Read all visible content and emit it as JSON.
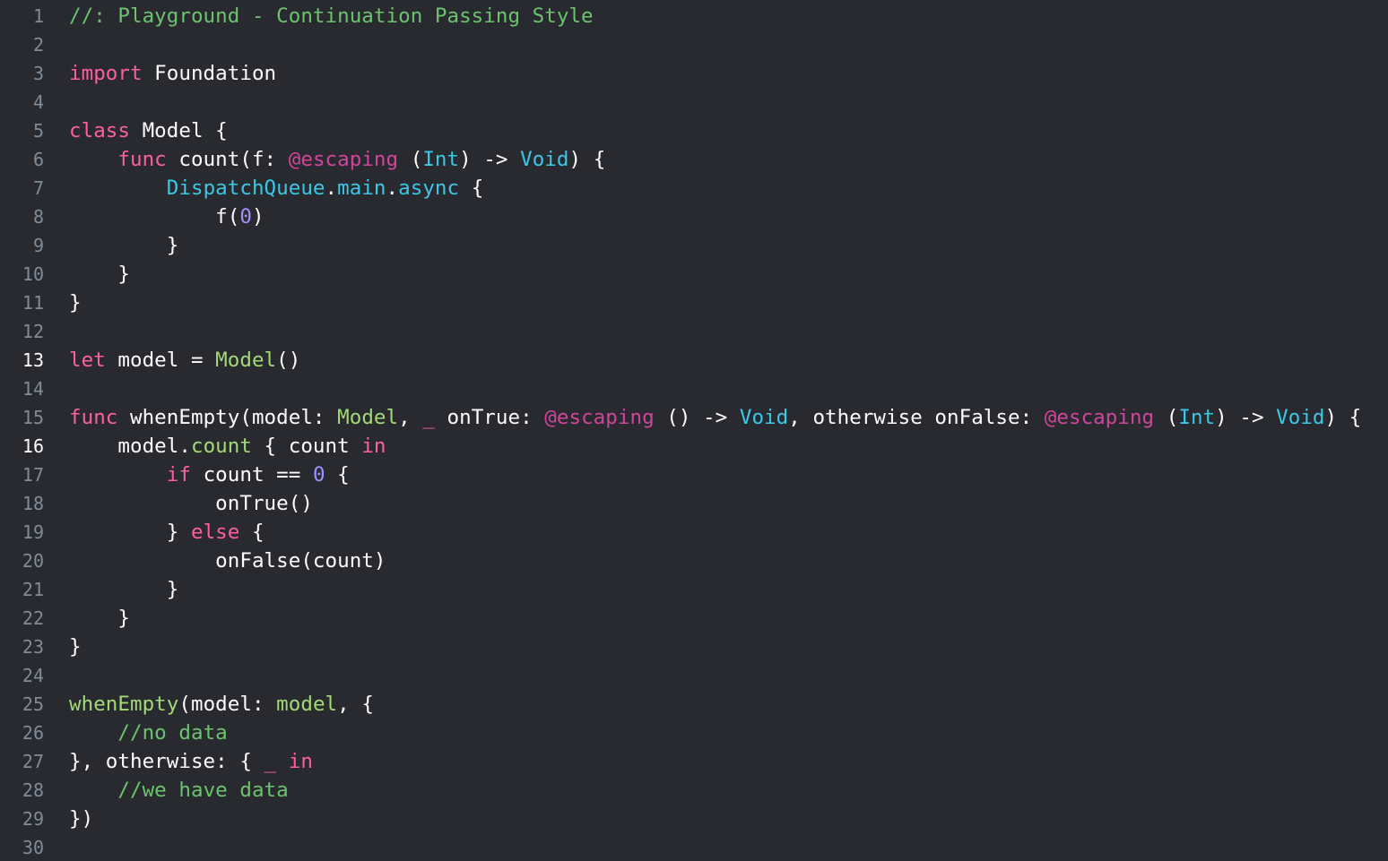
{
  "editor": {
    "current_line": 16,
    "highlight_lines": [
      13,
      16
    ],
    "colors": {
      "background": "#292a30",
      "keyword": "#fc5fa3",
      "attribute": "#d0459b",
      "system_type": "#39c8e6",
      "project_symbol": "#a3d977",
      "comment": "#6bc46d",
      "number": "#a191ff",
      "plain": "#ffffff",
      "line_number": "#7f8c98"
    },
    "lines": [
      {
        "n": "1",
        "tokens": [
          {
            "t": "//: Playground - Continuation Passing Style",
            "c": "cm"
          }
        ]
      },
      {
        "n": "2",
        "tokens": []
      },
      {
        "n": "3",
        "tokens": [
          {
            "t": "import",
            "c": "kw"
          },
          {
            "t": " Foundation",
            "c": "plain"
          }
        ]
      },
      {
        "n": "4",
        "tokens": []
      },
      {
        "n": "5",
        "tokens": [
          {
            "t": "class",
            "c": "kw"
          },
          {
            "t": " Model {",
            "c": "plain"
          }
        ]
      },
      {
        "n": "6",
        "tokens": [
          {
            "t": "    ",
            "c": "plain"
          },
          {
            "t": "func",
            "c": "kw"
          },
          {
            "t": " count(f: ",
            "c": "plain"
          },
          {
            "t": "@escaping",
            "c": "attr"
          },
          {
            "t": " (",
            "c": "plain"
          },
          {
            "t": "Int",
            "c": "sys"
          },
          {
            "t": ") -> ",
            "c": "plain"
          },
          {
            "t": "Void",
            "c": "sys"
          },
          {
            "t": ") {",
            "c": "plain"
          }
        ]
      },
      {
        "n": "7",
        "tokens": [
          {
            "t": "        ",
            "c": "plain"
          },
          {
            "t": "DispatchQueue",
            "c": "sys"
          },
          {
            "t": ".",
            "c": "plain"
          },
          {
            "t": "main",
            "c": "sys"
          },
          {
            "t": ".",
            "c": "plain"
          },
          {
            "t": "async",
            "c": "sys"
          },
          {
            "t": " {",
            "c": "plain"
          }
        ]
      },
      {
        "n": "8",
        "tokens": [
          {
            "t": "            f(",
            "c": "plain"
          },
          {
            "t": "0",
            "c": "num"
          },
          {
            "t": ")",
            "c": "plain"
          }
        ]
      },
      {
        "n": "9",
        "tokens": [
          {
            "t": "        }",
            "c": "plain"
          }
        ]
      },
      {
        "n": "10",
        "tokens": [
          {
            "t": "    }",
            "c": "plain"
          }
        ]
      },
      {
        "n": "11",
        "tokens": [
          {
            "t": "}",
            "c": "plain"
          }
        ]
      },
      {
        "n": "12",
        "tokens": []
      },
      {
        "n": "13",
        "tokens": [
          {
            "t": "let",
            "c": "kw"
          },
          {
            "t": " model = ",
            "c": "plain"
          },
          {
            "t": "Model",
            "c": "proj"
          },
          {
            "t": "()",
            "c": "plain"
          }
        ]
      },
      {
        "n": "14",
        "tokens": []
      },
      {
        "n": "15",
        "tokens": [
          {
            "t": "func",
            "c": "kw"
          },
          {
            "t": " whenEmpty(model: ",
            "c": "plain"
          },
          {
            "t": "Model",
            "c": "proj"
          },
          {
            "t": ", ",
            "c": "plain"
          },
          {
            "t": "_",
            "c": "kw"
          },
          {
            "t": " onTrue: ",
            "c": "plain"
          },
          {
            "t": "@escaping",
            "c": "attr"
          },
          {
            "t": " () -> ",
            "c": "plain"
          },
          {
            "t": "Void",
            "c": "sys"
          },
          {
            "t": ", otherwise onFalse: ",
            "c": "plain"
          },
          {
            "t": "@escaping",
            "c": "attr"
          },
          {
            "t": " (",
            "c": "plain"
          },
          {
            "t": "Int",
            "c": "sys"
          },
          {
            "t": ") -> ",
            "c": "plain"
          },
          {
            "t": "Void",
            "c": "sys"
          },
          {
            "t": ") {",
            "c": "plain"
          }
        ]
      },
      {
        "n": "16",
        "tokens": [
          {
            "t": "    model.",
            "c": "plain"
          },
          {
            "t": "count",
            "c": "proj"
          },
          {
            "t": " { count ",
            "c": "plain"
          },
          {
            "t": "in",
            "c": "kw"
          }
        ]
      },
      {
        "n": "17",
        "tokens": [
          {
            "t": "        ",
            "c": "plain"
          },
          {
            "t": "if",
            "c": "kw"
          },
          {
            "t": " count == ",
            "c": "plain"
          },
          {
            "t": "0",
            "c": "num"
          },
          {
            "t": " {",
            "c": "plain"
          }
        ]
      },
      {
        "n": "18",
        "tokens": [
          {
            "t": "            onTrue()",
            "c": "plain"
          }
        ]
      },
      {
        "n": "19",
        "tokens": [
          {
            "t": "        } ",
            "c": "plain"
          },
          {
            "t": "else",
            "c": "kw"
          },
          {
            "t": " {",
            "c": "plain"
          }
        ]
      },
      {
        "n": "20",
        "tokens": [
          {
            "t": "            onFalse(count)",
            "c": "plain"
          }
        ]
      },
      {
        "n": "21",
        "tokens": [
          {
            "t": "        }",
            "c": "plain"
          }
        ]
      },
      {
        "n": "22",
        "tokens": [
          {
            "t": "    }",
            "c": "plain"
          }
        ]
      },
      {
        "n": "23",
        "tokens": [
          {
            "t": "}",
            "c": "plain"
          }
        ]
      },
      {
        "n": "24",
        "tokens": []
      },
      {
        "n": "25",
        "tokens": [
          {
            "t": "whenEmpty",
            "c": "proj"
          },
          {
            "t": "(model: ",
            "c": "plain"
          },
          {
            "t": "model",
            "c": "proj"
          },
          {
            "t": ", {",
            "c": "plain"
          }
        ]
      },
      {
        "n": "26",
        "tokens": [
          {
            "t": "    ",
            "c": "plain"
          },
          {
            "t": "//no data",
            "c": "cm"
          }
        ]
      },
      {
        "n": "27",
        "tokens": [
          {
            "t": "}, otherwise: { ",
            "c": "plain"
          },
          {
            "t": "_",
            "c": "kw"
          },
          {
            "t": " ",
            "c": "plain"
          },
          {
            "t": "in",
            "c": "kw"
          }
        ]
      },
      {
        "n": "28",
        "tokens": [
          {
            "t": "    ",
            "c": "plain"
          },
          {
            "t": "//we have data",
            "c": "cm"
          }
        ]
      },
      {
        "n": "29",
        "tokens": [
          {
            "t": "})",
            "c": "plain"
          }
        ]
      },
      {
        "n": "30",
        "tokens": []
      }
    ]
  }
}
